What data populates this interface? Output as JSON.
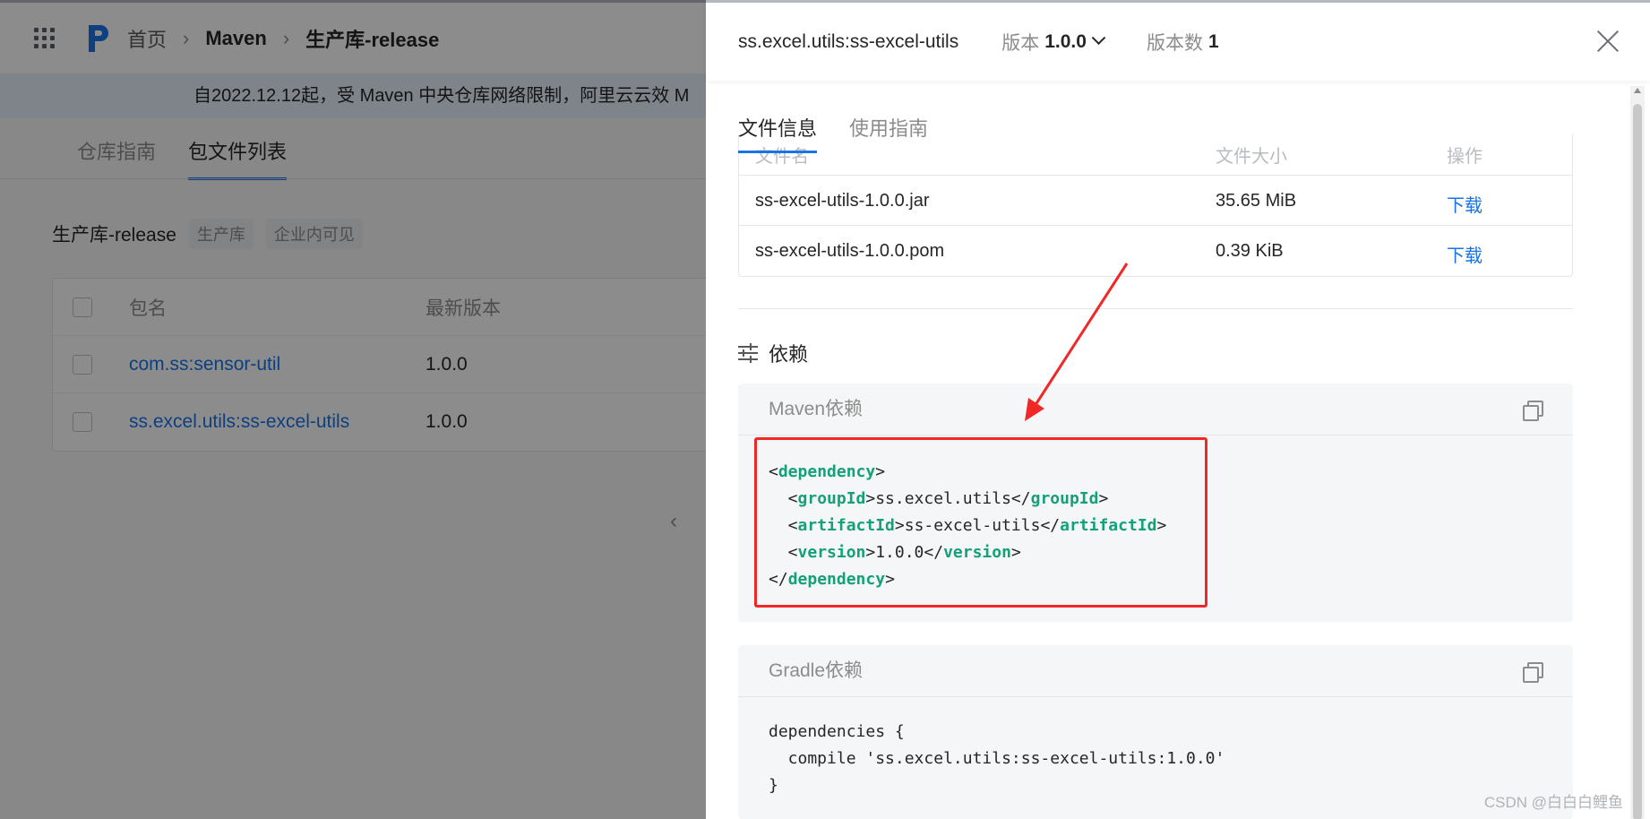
{
  "background_page": {
    "breadcrumb": {
      "home": "首页",
      "section": "Maven",
      "repo": "生产库-release"
    },
    "notice": "自2022.12.12起，受 Maven 中央仓库网络限制，阿里云云效 M",
    "tabs": [
      {
        "label": "仓库指南"
      },
      {
        "label": "包文件列表"
      }
    ],
    "repo_title": "生产库-release",
    "repo_tags": [
      "生产库",
      "企业内可见"
    ],
    "table": {
      "headers": {
        "name": "包名",
        "version": "最新版本"
      },
      "rows": [
        {
          "name": "com.ss:sensor-util",
          "version": "1.0.0"
        },
        {
          "name": "ss.excel.utils:ss-excel-utils",
          "version": "1.0.0"
        }
      ]
    },
    "pager_prev": "‹"
  },
  "drawer": {
    "title": "ss.excel.utils:ss-excel-utils",
    "version_label": "版本",
    "version_value": "1.0.0",
    "version_count_label": "版本数",
    "version_count_value": "1",
    "tabs": [
      {
        "label": "文件信息"
      },
      {
        "label": "使用指南"
      }
    ],
    "file_table": {
      "headers": {
        "name": "文件名",
        "size": "文件大小",
        "action": "操作"
      },
      "rows": [
        {
          "name": "ss-excel-utils-1.0.0.jar",
          "size": "35.65 MiB",
          "action": "下载"
        },
        {
          "name": "ss-excel-utils-1.0.0.pom",
          "size": "0.39 KiB",
          "action": "下载"
        }
      ]
    },
    "deps_title": "依赖",
    "maven": {
      "title": "Maven依赖",
      "lines": {
        "l1_open": "<",
        "l1_tag": "dependency",
        "l1_close": ">",
        "l2_open": "  <",
        "l2_tag": "groupId",
        "l2_val": ">ss.excel.utils</",
        "l2_tag2": "groupId",
        "l2_close": ">",
        "l3_open": "  <",
        "l3_tag": "artifactId",
        "l3_val": ">ss-excel-utils</",
        "l3_tag2": "artifactId",
        "l3_close": ">",
        "l4_open": "  <",
        "l4_tag": "version",
        "l4_val": ">1.0.0</",
        "l4_tag2": "version",
        "l4_close": ">",
        "l5_open": "</",
        "l5_tag": "dependency",
        "l5_close": ">"
      }
    },
    "gradle": {
      "title": "Gradle依赖",
      "lines": [
        "dependencies {",
        "  compile 'ss.excel.utils:ss-excel-utils:1.0.0'",
        "}"
      ]
    }
  },
  "watermark": "CSDN @白白白鲤鱼",
  "colors": {
    "accent": "#1b73e8",
    "code_tag": "#14a17a",
    "annotation_red": "#f02828"
  }
}
